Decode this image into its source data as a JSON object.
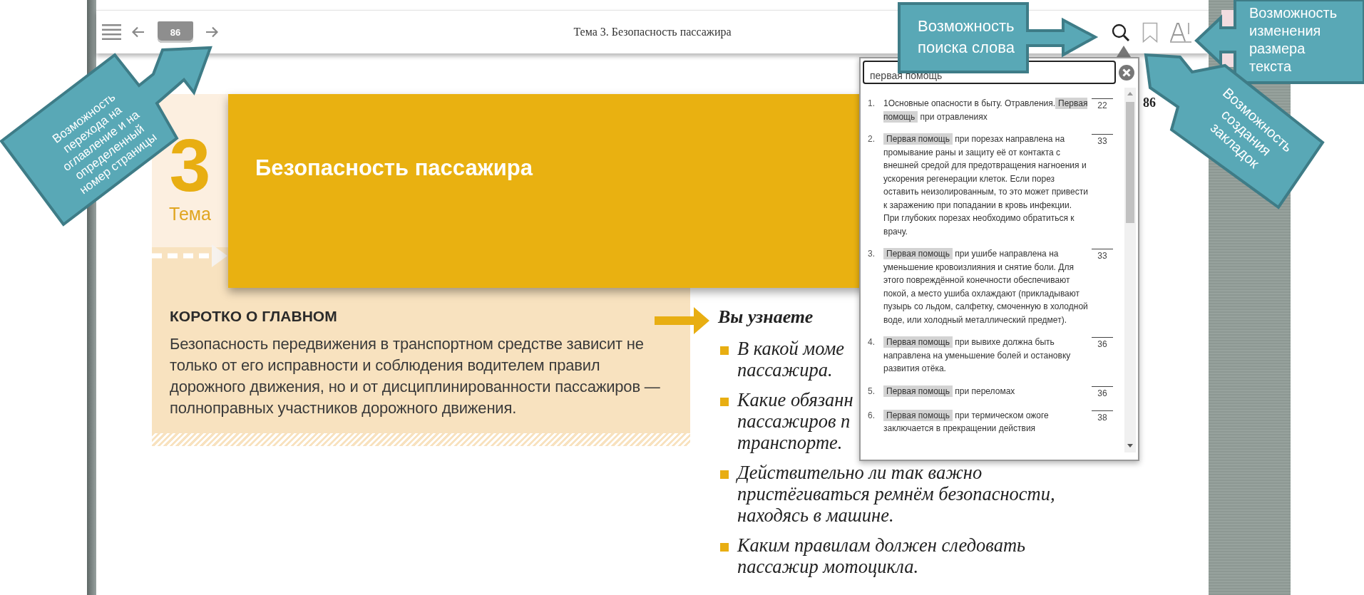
{
  "toolbar": {
    "page_badge": "86",
    "title": "Тема 3. Безопасность пассажира"
  },
  "page": {
    "page_number": "86",
    "chapter": {
      "number": "3",
      "label": "Тема",
      "title": "Безопасность пассажира"
    },
    "summary": {
      "heading": "КОРОТКО О ГЛАВНОМ",
      "text": "Безопасность передвижения в транспортном средстве зависит не только от его исправности и соблюдения водителем правил дорожного движения, но и от дисциплинированности пассажиров — полноправных участников дорожного движения."
    },
    "learn": {
      "heading": "Вы узнаете",
      "items": [
        {
          "lines": [
            "В какой моме",
            "пассажира."
          ]
        },
        {
          "lines": [
            "Какие обязанн",
            "пассажиров п",
            "транспорте."
          ]
        },
        {
          "lines": [
            "Действительно ли так важно",
            "пристёгиваться ремнём безопасности,",
            "находясь в машине."
          ]
        },
        {
          "lines": [
            "Каким правилам должен следовать",
            "пассажир мотоцикла."
          ]
        }
      ]
    }
  },
  "search_popup": {
    "query": "первая помощь",
    "results": [
      {
        "number": "1.",
        "before": "1Основные опасности в быту. Отравления.",
        "match": "Первая помощь",
        "after": "при отравлениях",
        "page": "22"
      },
      {
        "number": "2.",
        "match": "Первая помощь",
        "after": "при порезах направлена на промывание раны и защиту её от контакта с внешней средой для предотвращения нагноения и ускорения регенерации клеток. Если порез оставить неизолированным, то это может привести к заражению при попадании в кровь инфекции. При глубоких порезах необходимо обратиться к врачу.",
        "page": "33"
      },
      {
        "number": "3.",
        "match": "Первая помощь",
        "after": "при ушибе направлена на уменьшение кровоизлияния и снятие боли. Для этого повреждённой конечности обеспечивают покой, а место ушиба охлаждают (прикладывают пузырь со льдом, салфетку, смоченную в холодной воде, или холодный металлический предмет).",
        "page": "33"
      },
      {
        "number": "4.",
        "match": "Первая помощь",
        "after": "при вывихе должна быть направлена на уменьшение болей и остановку развития отёка.",
        "page": "36"
      },
      {
        "number": "5.",
        "match": "Первая помощь",
        "after": "при переломах",
        "page": "36"
      },
      {
        "number": "6.",
        "match": "Первая помощь",
        "after": "при термическом ожоге заключается в прекращении действия",
        "page": "38"
      }
    ]
  },
  "callouts": [
    {
      "text": "Возможность перехода на оглавление и на определенный номер страницы"
    },
    {
      "text": "Возможность поиска слова"
    },
    {
      "text": "Возможность изменения размера текста"
    },
    {
      "text": "Возможность создания закладок"
    }
  ]
}
